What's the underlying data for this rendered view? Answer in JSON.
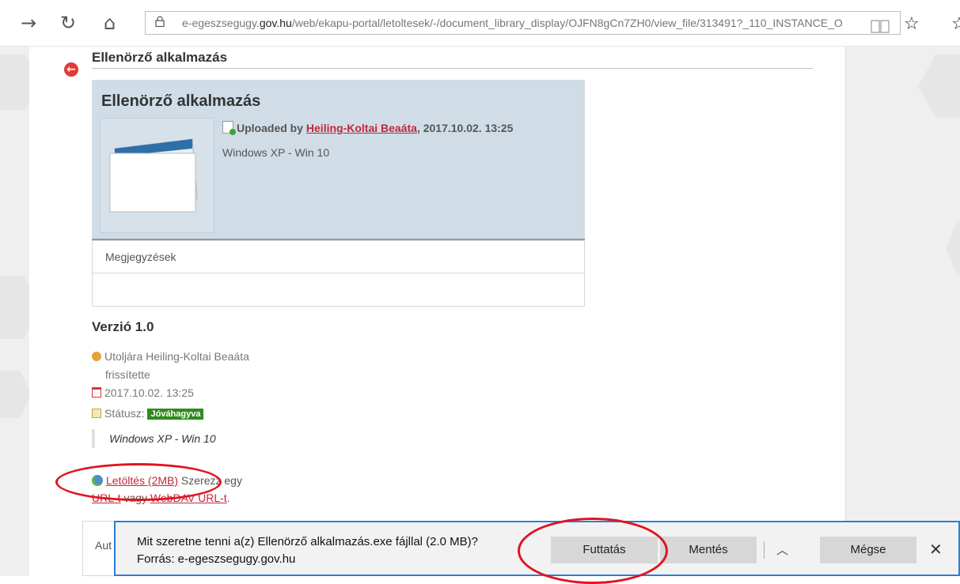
{
  "browser": {
    "url_prefix": "e-egeszsegugy.",
    "url_domain": "gov.hu",
    "url_path": "/web/ekapu-portal/letoltesek/-/document_library_display/OJFN8gCn7ZH0/view_file/313491?_110_INSTANCE_O"
  },
  "portlet": {
    "title": "Ellenörző alkalmazás"
  },
  "document": {
    "heading": "Ellenörző alkalmazás",
    "uploaded_by_prefix": "Uploaded by ",
    "uploader": "Heiling-Koltai Beaáta",
    "uploaded_suffix": ", 2017.10.02. 13:25",
    "description": "Windows XP - Win 10",
    "notes_label": "Megjegyzések"
  },
  "version": {
    "title": "Verzió 1.0",
    "updated_line1": "Utoljára Heiling-Koltai Beaáta",
    "updated_line2": "frissítette",
    "date": "2017.10.02. 13:25",
    "status_label": "Státusz:",
    "status_value": "Jóváhagyva",
    "description": "Windows XP - Win 10"
  },
  "download": {
    "link": "Letöltés (2MB)",
    "text_after": " Szerezz egy",
    "url_link": "URL-t",
    "or_text": " vagy ",
    "webdav_link": "WebDAV URL-t",
    "period": "."
  },
  "tab": {
    "label": "Aut"
  },
  "download_bar": {
    "message": "Mit szeretne tenni a(z) Ellenörző alkalmazás.exe fájllal (2.0 MB)?",
    "source": "Forrás: e-egeszsegugy.gov.hu",
    "run_label": "Futtatás",
    "save_label": "Mentés",
    "cancel_label": "Mégse"
  },
  "colors": {
    "accent_red": "#e0141e",
    "link": "#c0273b",
    "status_green": "#2e8b1f",
    "bar_border": "#2b7ed8"
  }
}
